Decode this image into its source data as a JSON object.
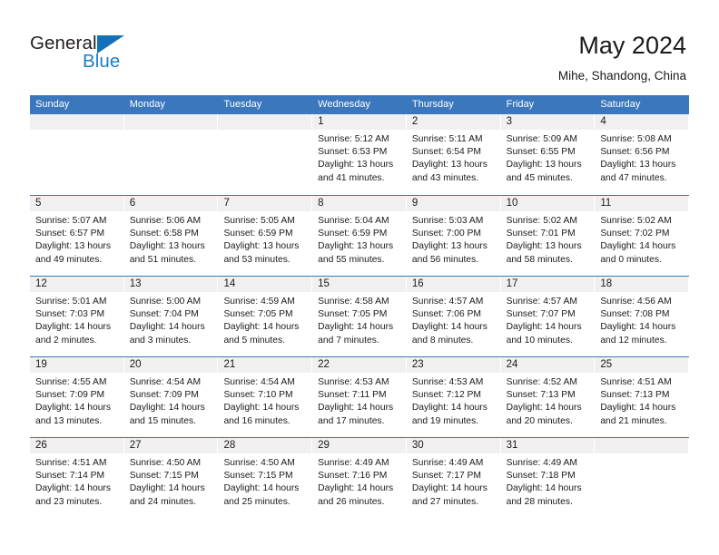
{
  "brand": {
    "name_part1": "General",
    "name_part2": "Blue",
    "triangle_color": "#1271b8",
    "blue_text_color": "#1c7ec4"
  },
  "header": {
    "title": "May 2024",
    "location": "Mihe, Shandong, China"
  },
  "theme": {
    "header_blue": "#3b77bc",
    "day_band_gray": "#f0f0f0",
    "text_color": "#1a1a1a"
  },
  "weekdays": [
    "Sunday",
    "Monday",
    "Tuesday",
    "Wednesday",
    "Thursday",
    "Friday",
    "Saturday"
  ],
  "weeks": [
    [
      {
        "day": "",
        "sunrise": "",
        "sunset": "",
        "daylight_1": "",
        "daylight_2": "",
        "empty": true
      },
      {
        "day": "",
        "sunrise": "",
        "sunset": "",
        "daylight_1": "",
        "daylight_2": "",
        "empty": true
      },
      {
        "day": "",
        "sunrise": "",
        "sunset": "",
        "daylight_1": "",
        "daylight_2": "",
        "empty": true
      },
      {
        "day": "1",
        "sunrise": "Sunrise: 5:12 AM",
        "sunset": "Sunset: 6:53 PM",
        "daylight_1": "Daylight: 13 hours",
        "daylight_2": "and 41 minutes."
      },
      {
        "day": "2",
        "sunrise": "Sunrise: 5:11 AM",
        "sunset": "Sunset: 6:54 PM",
        "daylight_1": "Daylight: 13 hours",
        "daylight_2": "and 43 minutes."
      },
      {
        "day": "3",
        "sunrise": "Sunrise: 5:09 AM",
        "sunset": "Sunset: 6:55 PM",
        "daylight_1": "Daylight: 13 hours",
        "daylight_2": "and 45 minutes."
      },
      {
        "day": "4",
        "sunrise": "Sunrise: 5:08 AM",
        "sunset": "Sunset: 6:56 PM",
        "daylight_1": "Daylight: 13 hours",
        "daylight_2": "and 47 minutes."
      }
    ],
    [
      {
        "day": "5",
        "sunrise": "Sunrise: 5:07 AM",
        "sunset": "Sunset: 6:57 PM",
        "daylight_1": "Daylight: 13 hours",
        "daylight_2": "and 49 minutes."
      },
      {
        "day": "6",
        "sunrise": "Sunrise: 5:06 AM",
        "sunset": "Sunset: 6:58 PM",
        "daylight_1": "Daylight: 13 hours",
        "daylight_2": "and 51 minutes."
      },
      {
        "day": "7",
        "sunrise": "Sunrise: 5:05 AM",
        "sunset": "Sunset: 6:59 PM",
        "daylight_1": "Daylight: 13 hours",
        "daylight_2": "and 53 minutes."
      },
      {
        "day": "8",
        "sunrise": "Sunrise: 5:04 AM",
        "sunset": "Sunset: 6:59 PM",
        "daylight_1": "Daylight: 13 hours",
        "daylight_2": "and 55 minutes."
      },
      {
        "day": "9",
        "sunrise": "Sunrise: 5:03 AM",
        "sunset": "Sunset: 7:00 PM",
        "daylight_1": "Daylight: 13 hours",
        "daylight_2": "and 56 minutes."
      },
      {
        "day": "10",
        "sunrise": "Sunrise: 5:02 AM",
        "sunset": "Sunset: 7:01 PM",
        "daylight_1": "Daylight: 13 hours",
        "daylight_2": "and 58 minutes."
      },
      {
        "day": "11",
        "sunrise": "Sunrise: 5:02 AM",
        "sunset": "Sunset: 7:02 PM",
        "daylight_1": "Daylight: 14 hours",
        "daylight_2": "and 0 minutes."
      }
    ],
    [
      {
        "day": "12",
        "sunrise": "Sunrise: 5:01 AM",
        "sunset": "Sunset: 7:03 PM",
        "daylight_1": "Daylight: 14 hours",
        "daylight_2": "and 2 minutes."
      },
      {
        "day": "13",
        "sunrise": "Sunrise: 5:00 AM",
        "sunset": "Sunset: 7:04 PM",
        "daylight_1": "Daylight: 14 hours",
        "daylight_2": "and 3 minutes."
      },
      {
        "day": "14",
        "sunrise": "Sunrise: 4:59 AM",
        "sunset": "Sunset: 7:05 PM",
        "daylight_1": "Daylight: 14 hours",
        "daylight_2": "and 5 minutes."
      },
      {
        "day": "15",
        "sunrise": "Sunrise: 4:58 AM",
        "sunset": "Sunset: 7:05 PM",
        "daylight_1": "Daylight: 14 hours",
        "daylight_2": "and 7 minutes."
      },
      {
        "day": "16",
        "sunrise": "Sunrise: 4:57 AM",
        "sunset": "Sunset: 7:06 PM",
        "daylight_1": "Daylight: 14 hours",
        "daylight_2": "and 8 minutes."
      },
      {
        "day": "17",
        "sunrise": "Sunrise: 4:57 AM",
        "sunset": "Sunset: 7:07 PM",
        "daylight_1": "Daylight: 14 hours",
        "daylight_2": "and 10 minutes."
      },
      {
        "day": "18",
        "sunrise": "Sunrise: 4:56 AM",
        "sunset": "Sunset: 7:08 PM",
        "daylight_1": "Daylight: 14 hours",
        "daylight_2": "and 12 minutes."
      }
    ],
    [
      {
        "day": "19",
        "sunrise": "Sunrise: 4:55 AM",
        "sunset": "Sunset: 7:09 PM",
        "daylight_1": "Daylight: 14 hours",
        "daylight_2": "and 13 minutes."
      },
      {
        "day": "20",
        "sunrise": "Sunrise: 4:54 AM",
        "sunset": "Sunset: 7:09 PM",
        "daylight_1": "Daylight: 14 hours",
        "daylight_2": "and 15 minutes."
      },
      {
        "day": "21",
        "sunrise": "Sunrise: 4:54 AM",
        "sunset": "Sunset: 7:10 PM",
        "daylight_1": "Daylight: 14 hours",
        "daylight_2": "and 16 minutes."
      },
      {
        "day": "22",
        "sunrise": "Sunrise: 4:53 AM",
        "sunset": "Sunset: 7:11 PM",
        "daylight_1": "Daylight: 14 hours",
        "daylight_2": "and 17 minutes."
      },
      {
        "day": "23",
        "sunrise": "Sunrise: 4:53 AM",
        "sunset": "Sunset: 7:12 PM",
        "daylight_1": "Daylight: 14 hours",
        "daylight_2": "and 19 minutes."
      },
      {
        "day": "24",
        "sunrise": "Sunrise: 4:52 AM",
        "sunset": "Sunset: 7:13 PM",
        "daylight_1": "Daylight: 14 hours",
        "daylight_2": "and 20 minutes."
      },
      {
        "day": "25",
        "sunrise": "Sunrise: 4:51 AM",
        "sunset": "Sunset: 7:13 PM",
        "daylight_1": "Daylight: 14 hours",
        "daylight_2": "and 21 minutes."
      }
    ],
    [
      {
        "day": "26",
        "sunrise": "Sunrise: 4:51 AM",
        "sunset": "Sunset: 7:14 PM",
        "daylight_1": "Daylight: 14 hours",
        "daylight_2": "and 23 minutes."
      },
      {
        "day": "27",
        "sunrise": "Sunrise: 4:50 AM",
        "sunset": "Sunset: 7:15 PM",
        "daylight_1": "Daylight: 14 hours",
        "daylight_2": "and 24 minutes."
      },
      {
        "day": "28",
        "sunrise": "Sunrise: 4:50 AM",
        "sunset": "Sunset: 7:15 PM",
        "daylight_1": "Daylight: 14 hours",
        "daylight_2": "and 25 minutes."
      },
      {
        "day": "29",
        "sunrise": "Sunrise: 4:49 AM",
        "sunset": "Sunset: 7:16 PM",
        "daylight_1": "Daylight: 14 hours",
        "daylight_2": "and 26 minutes."
      },
      {
        "day": "30",
        "sunrise": "Sunrise: 4:49 AM",
        "sunset": "Sunset: 7:17 PM",
        "daylight_1": "Daylight: 14 hours",
        "daylight_2": "and 27 minutes."
      },
      {
        "day": "31",
        "sunrise": "Sunrise: 4:49 AM",
        "sunset": "Sunset: 7:18 PM",
        "daylight_1": "Daylight: 14 hours",
        "daylight_2": "and 28 minutes."
      },
      {
        "day": "",
        "sunrise": "",
        "sunset": "",
        "daylight_1": "",
        "daylight_2": "",
        "empty": true
      }
    ]
  ]
}
